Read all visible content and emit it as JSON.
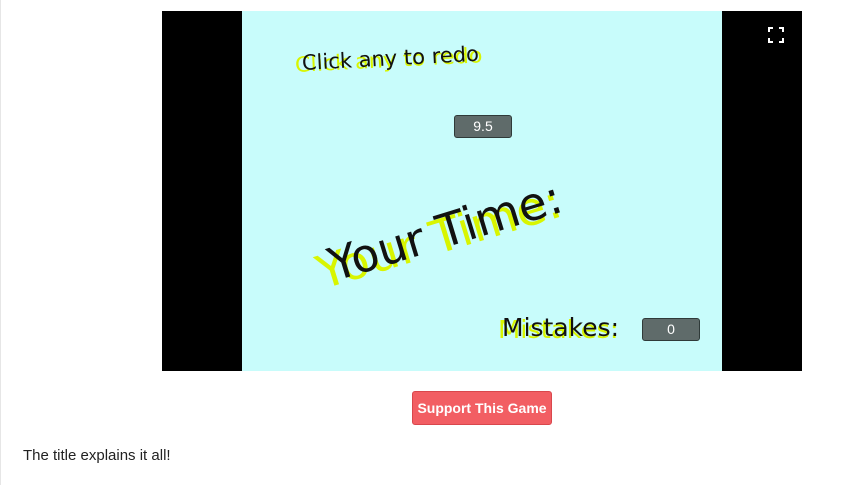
{
  "game": {
    "redo_text": "Click any to redo",
    "timer_value": "9.5",
    "time_title": "Your Time:",
    "mistakes_label": "Mistakes:",
    "mistakes_value": "0",
    "fullscreen_icon": "fullscreen-icon",
    "colors": {
      "canvas_background": "#c8fcfb",
      "letterbox": "#000000",
      "text_shadow": "#d8f500",
      "monitor_background": "#5f6b6a"
    }
  },
  "page": {
    "support_button_label": "Support This Game",
    "description": "The title explains it all!",
    "support_button_color": "#f25e63"
  }
}
